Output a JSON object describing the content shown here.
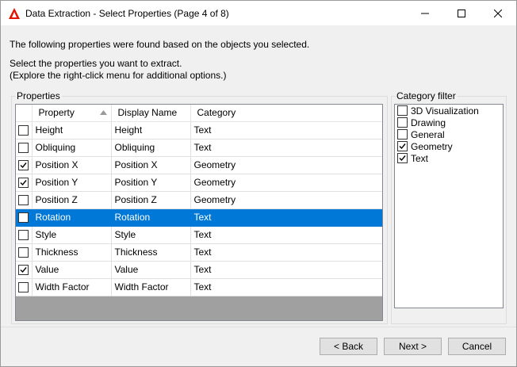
{
  "window": {
    "title": "Data Extraction - Select Properties (Page 4 of 8)"
  },
  "intro": {
    "line1": "The following properties were found based on the objects you selected.",
    "line2": "Select the properties you want to extract.",
    "line3": "(Explore the right-click menu for additional options.)"
  },
  "properties_group": {
    "label": "Properties",
    "columns": [
      "Property",
      "Display Name",
      "Category"
    ],
    "rows": [
      {
        "checked": false,
        "property": "Height",
        "display_name": "Height",
        "category": "Text"
      },
      {
        "checked": false,
        "property": "Obliquing",
        "display_name": "Obliquing",
        "category": "Text"
      },
      {
        "checked": true,
        "property": "Position X",
        "display_name": "Position X",
        "category": "Geometry"
      },
      {
        "checked": true,
        "property": "Position Y",
        "display_name": "Position Y",
        "category": "Geometry"
      },
      {
        "checked": false,
        "property": "Position Z",
        "display_name": "Position Z",
        "category": "Geometry"
      },
      {
        "checked": false,
        "property": "Rotation",
        "display_name": "Rotation",
        "category": "Text",
        "selected": true
      },
      {
        "checked": false,
        "property": "Style",
        "display_name": "Style",
        "category": "Text"
      },
      {
        "checked": false,
        "property": "Thickness",
        "display_name": "Thickness",
        "category": "Text"
      },
      {
        "checked": true,
        "property": "Value",
        "display_name": "Value",
        "category": "Text"
      },
      {
        "checked": false,
        "property": "Width Factor",
        "display_name": "Width Factor",
        "category": "Text"
      }
    ]
  },
  "category_filter": {
    "label": "Category filter",
    "items": [
      {
        "label": "3D Visualization",
        "checked": false
      },
      {
        "label": "Drawing",
        "checked": false
      },
      {
        "label": "General",
        "checked": false
      },
      {
        "label": "Geometry",
        "checked": true
      },
      {
        "label": "Text",
        "checked": true
      }
    ]
  },
  "buttons": {
    "back": "< Back",
    "next": "Next >",
    "cancel": "Cancel"
  },
  "colors": {
    "selection": "#0078d7",
    "brand_icon": "#e51400"
  }
}
